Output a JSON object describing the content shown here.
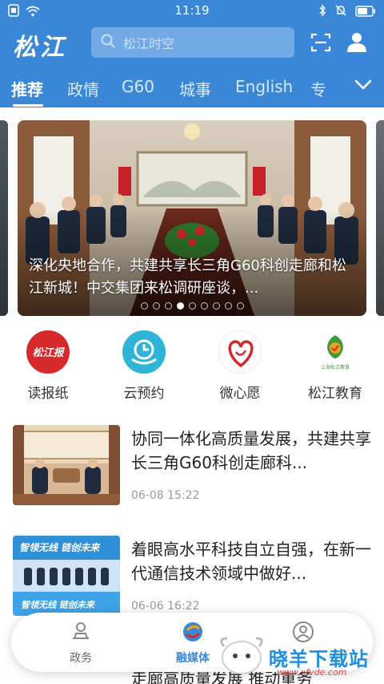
{
  "status_bar": {
    "time": "11:19"
  },
  "header": {
    "logo": "松江",
    "search_placeholder": "松江时空"
  },
  "tabs": [
    {
      "label": "推荐",
      "active": true
    },
    {
      "label": "政情"
    },
    {
      "label": "G60"
    },
    {
      "label": "城事"
    },
    {
      "label": "English"
    },
    {
      "label": "专"
    }
  ],
  "carousel": {
    "caption": "深化央地合作，共建共享长三角G60科创走廊和松江新城！中交集团来松调研座谈，...",
    "active_index": 3,
    "count": 9
  },
  "quick_links": [
    {
      "label": "读报纸",
      "icon": "newspaper-logo-icon",
      "logo_text": "松江报"
    },
    {
      "label": "云预约",
      "icon": "cloud-appointment-icon"
    },
    {
      "label": "微心愿",
      "icon": "heart-wish-icon"
    },
    {
      "label": "松江教育",
      "icon": "education-logo-icon",
      "logo_text": "上海松江教育"
    }
  ],
  "news": [
    {
      "title": "协同一体化高质量发展，共建共享长三角G60科创走廊科...",
      "time": "06-08 15:22"
    },
    {
      "title": "着眼高水平科技自立自强，在新一代通信技术领域中做好...",
      "time": "06-06 16:22",
      "thumb_text_top": "智领无线 链创未来",
      "thumb_text_bottom": "智领无线 链创未来"
    },
    {
      "title": "走廊高质量发展  推动重务"
    }
  ],
  "bottom_nav": [
    {
      "label": "政务",
      "icon": "government-icon"
    },
    {
      "label": "融媒体",
      "icon": "media-logo-icon",
      "active": true
    },
    {
      "label": "",
      "icon": "service-icon"
    }
  ],
  "watermark": {
    "text": "晓羊下载站",
    "url": "www.xfyde.com"
  },
  "colors": {
    "brand_blue": "#3a87d8",
    "search_bg": "#71aae5"
  }
}
